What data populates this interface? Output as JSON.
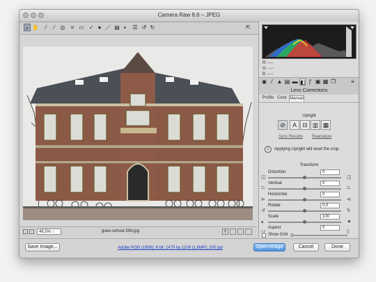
{
  "window": {
    "title": "Camera Raw 8.6  –  JPEG"
  },
  "toolbar": {
    "tools": [
      "zoom-tool",
      "hand-tool",
      "white-balance-tool",
      "color-sampler-tool",
      "targeted-adjustment-tool",
      "crop-tool",
      "straighten-tool",
      "spot-removal-tool",
      "red-eye-tool",
      "adjustment-brush-tool",
      "graduated-filter-tool",
      "radial-filter-tool",
      "preferences-tool",
      "rotate-ccw-tool",
      "rotate-cw-tool"
    ],
    "fullscreen": "fullscreen-toggle"
  },
  "preview": {
    "filename": "goes-school-394.jpg",
    "zoom": "46,5%"
  },
  "histogram": {
    "r": "R:",
    "g": "G:",
    "b": "B:",
    "r_val": "----",
    "g_val": "----",
    "b_val": "----"
  },
  "panel": {
    "title": "Lens Corrections",
    "tabs": [
      "Profile",
      "Color",
      "Manual"
    ],
    "upright_label": "Upright",
    "sync_results": "Sync Results",
    "reanalyze": "Reanalyze",
    "note": "Applying Upright will reset the crop.",
    "transform_label": "Transform",
    "sliders": [
      {
        "label": "Distortion",
        "value": "0"
      },
      {
        "label": "Vertical",
        "value": "0"
      },
      {
        "label": "Horizontal",
        "value": "0"
      },
      {
        "label": "Rotate",
        "value": "0,0"
      },
      {
        "label": "Scale",
        "value": "100"
      },
      {
        "label": "Aspect",
        "value": "0"
      }
    ],
    "show_grid": "Show Grid"
  },
  "bottom": {
    "save_image": "Save Image...",
    "workflow_link": "Adobe RGB (1998); 8 bit; 1479 by 1108 (1,6MP); 300 ppi",
    "open_image": "Open Image",
    "cancel": "Cancel",
    "done": "Done"
  },
  "colors": {
    "accent": "#4e93dd",
    "link": "#1c3fc5",
    "histogram_bg": "#1c1c1c"
  }
}
